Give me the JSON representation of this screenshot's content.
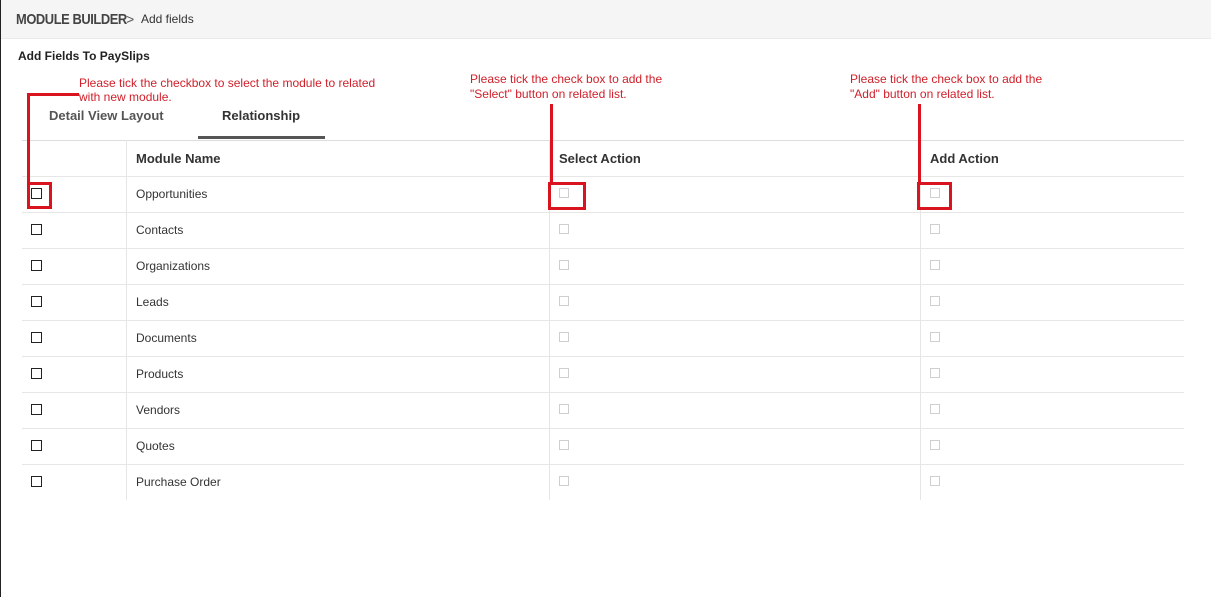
{
  "breadcrumb": {
    "title": "MODULE BUILDER",
    "separator": ">",
    "current": "Add fields"
  },
  "subtitle": "Add Fields To PaySlips",
  "tabs": [
    {
      "label": "Detail View Layout"
    },
    {
      "label": "Relationship",
      "active": true
    }
  ],
  "table": {
    "headers": {
      "module": "Module Name",
      "select": "Select Action",
      "add": "Add Action"
    },
    "rows": [
      "Opportunities",
      "Contacts",
      "Organizations",
      "Leads",
      "Documents",
      "Products",
      "Vendors",
      "Quotes",
      "Purchase Order"
    ]
  },
  "annotations": {
    "module_line1": "Please tick the checkbox to select the module to related",
    "module_line2": "with new module.",
    "select_line1": "Please tick the check box to add the",
    "select_line2": "\"Select\" button on related list.",
    "add_line1": "Please tick the check box to add the",
    "add_line2": "\"Add\" button on related list."
  },
  "colors": {
    "annotation": "#d9141e",
    "text": "#333333",
    "topbar": "#f5f5f5"
  }
}
